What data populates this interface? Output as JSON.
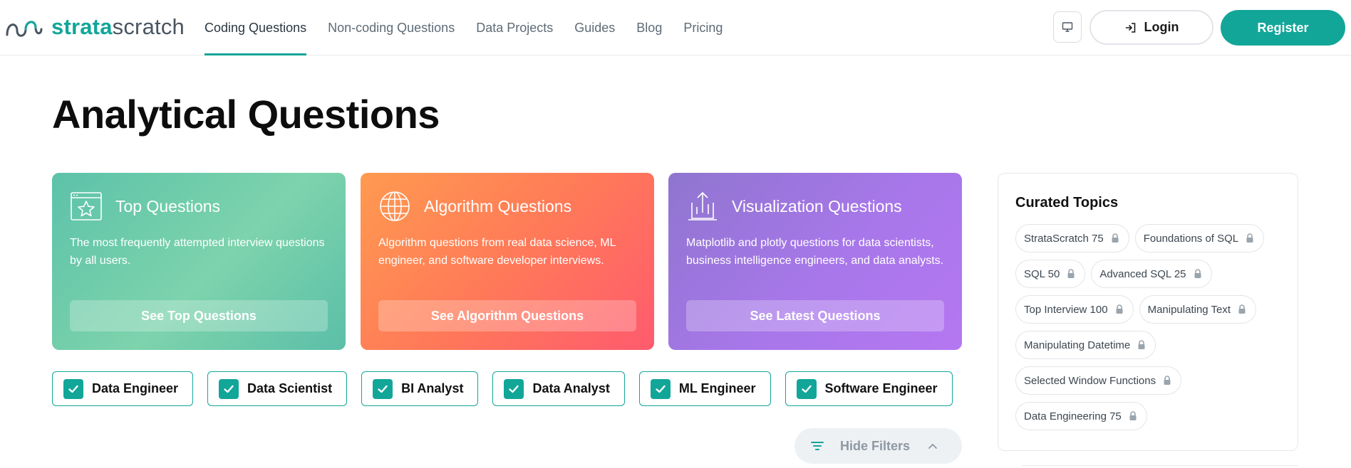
{
  "brand": {
    "name_part1": "strata",
    "name_part2": "scratch",
    "accent": "#12a699"
  },
  "nav": {
    "items": [
      {
        "label": "Coding Questions",
        "active": true
      },
      {
        "label": "Non-coding Questions",
        "active": false
      },
      {
        "label": "Data Projects",
        "active": false
      },
      {
        "label": "Guides",
        "active": false
      },
      {
        "label": "Blog",
        "active": false
      },
      {
        "label": "Pricing",
        "active": false
      }
    ],
    "login_label": "Login",
    "register_label": "Register"
  },
  "page": {
    "title": "Analytical Questions"
  },
  "cards": [
    {
      "title": "Top Questions",
      "description": "The most frequently attempted interview questions by all users.",
      "button": "See Top Questions",
      "icon": "star-window-icon"
    },
    {
      "title": "Algorithm Questions",
      "description": "Algorithm questions from real data science, ML engineer, and software developer interviews.",
      "button": "See Algorithm Questions",
      "icon": "globe-icon"
    },
    {
      "title": "Visualization Questions",
      "description": "Matplotlib and plotly questions for data scientists, business intelligence engineers, and data analysts.",
      "button": "See Latest Questions",
      "icon": "chart-upload-icon"
    }
  ],
  "filters": {
    "roles": [
      {
        "label": "Data Engineer",
        "checked": true
      },
      {
        "label": "Data Scientist",
        "checked": true
      },
      {
        "label": "BI Analyst",
        "checked": true
      },
      {
        "label": "Data Analyst",
        "checked": true
      },
      {
        "label": "ML Engineer",
        "checked": true
      },
      {
        "label": "Software Engineer",
        "checked": true
      }
    ],
    "hide_label": "Hide Filters"
  },
  "curated": {
    "title": "Curated Topics",
    "topics": [
      "StrataScratch 75",
      "Foundations of SQL",
      "SQL 50",
      "Advanced SQL 25",
      "Top Interview 100",
      "Manipulating Text",
      "Manipulating Datetime",
      "Selected Window Functions",
      "Data Engineering 75"
    ]
  }
}
